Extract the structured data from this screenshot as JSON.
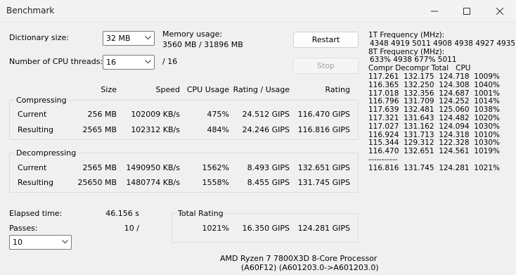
{
  "window": {
    "title": "Benchmark"
  },
  "controls": {
    "dict_label": "Dictionary size:",
    "dict_value": "32 MB",
    "threads_label": "Number of CPU threads:",
    "threads_value": "16",
    "threads_total": "/ 16",
    "memory_label": "Memory usage:",
    "memory_value": "3560 MB / 31896 MB",
    "restart_label": "Restart",
    "stop_label": "Stop"
  },
  "headers": {
    "size": "Size",
    "speed": "Speed",
    "cpu_usage": "CPU Usage",
    "rating_usage": "Rating / Usage",
    "rating": "Rating"
  },
  "compressing": {
    "title": "Compressing",
    "current": {
      "label": "Current",
      "size": "256 MB",
      "speed": "102009 KB/s",
      "cpu": "475%",
      "rating_usage": "24.512 GIPS",
      "rating": "116.470 GIPS"
    },
    "resulting": {
      "label": "Resulting",
      "size": "2565 MB",
      "speed": "102312 KB/s",
      "cpu": "484%",
      "rating_usage": "24.246 GIPS",
      "rating": "116.816 GIPS"
    }
  },
  "decompressing": {
    "title": "Decompressing",
    "current": {
      "label": "Current",
      "size": "2565 MB",
      "speed": "1490950 KB/s",
      "cpu": "1562%",
      "rating_usage": "8.493 GIPS",
      "rating": "132.651 GIPS"
    },
    "resulting": {
      "label": "Resulting",
      "size": "25650 MB",
      "speed": "1480774 KB/s",
      "cpu": "1558%",
      "rating_usage": "8.455 GIPS",
      "rating": "131.745 GIPS"
    }
  },
  "bottom": {
    "elapsed_label": "Elapsed time:",
    "elapsed_value": "46.156 s",
    "passes_label": "Passes:",
    "passes_value": "10 /",
    "passes_select": "10",
    "total_title": "Total Rating",
    "total_cpu": "1021%",
    "total_rating_usage": "16.350 GIPS",
    "total_rating": "124.281 GIPS",
    "cpu_name": "AMD Ryzen 7 7800X3D 8-Core Processor",
    "cpu_id": "(A60F12) (A601203.0->A601203.0)"
  },
  "side": {
    "freq1_label": "1T Frequency (MHz):",
    "freq1_values": "4348 4919 5011 4908 4938 4927 4935",
    "freq8_label": "8T Frequency (MHz):",
    "freq8_values": "633% 4938 677% 5011",
    "table_header": "Compr Decompr Total   CPU",
    "rows": [
      "117.261  132.175  124.718  1009%",
      "116.365  132.250  124.308  1040%",
      "117.018  132.356  124.687  1001%",
      "116.796  131.709  124.252  1014%",
      "117.639  132.481  125.060  1038%",
      "117.321  131.643  124.482  1020%",
      "117.027  131.162  124.094  1030%",
      "116.924  131.713  124.318  1010%",
      "115.344  129.312  122.328  1030%",
      "116.470  132.651  124.561  1019%"
    ],
    "separator": "-----------",
    "total_row": "116.816  131.745  124.281  1021%"
  }
}
